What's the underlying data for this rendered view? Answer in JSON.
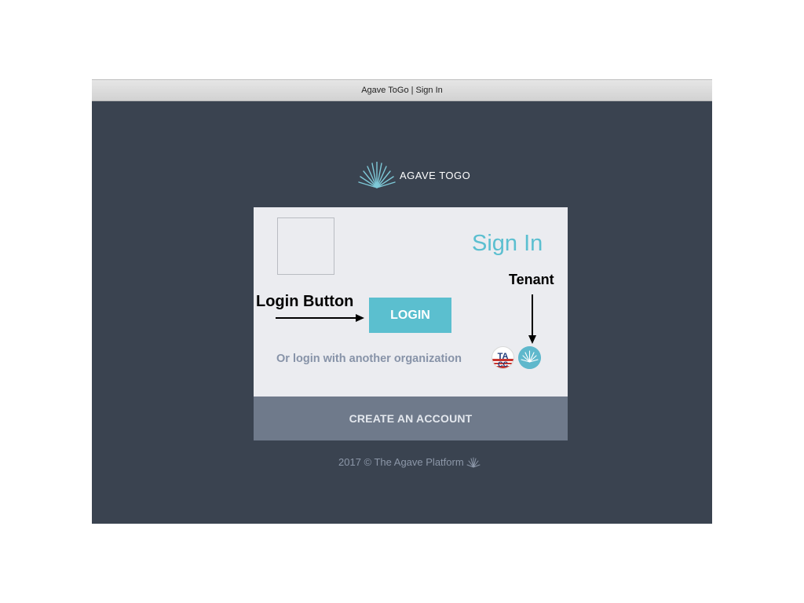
{
  "window": {
    "title": "Agave ToGo | Sign In",
    "background_color": "#3a4350"
  },
  "brand": {
    "name": "AGAVE TOGO",
    "icon": "agave-leaf-icon"
  },
  "signin_card": {
    "title": "Sign In",
    "login_button": "LOGIN",
    "alt_login_text": "Or login with another organization",
    "tenants": [
      {
        "name": "TACC",
        "icon": "tacc-tenant-icon"
      },
      {
        "name": "Agave",
        "icon": "agave-tenant-icon"
      }
    ],
    "accent_color": "#5bbfcf"
  },
  "create_account": {
    "label": "CREATE AN ACCOUNT",
    "color": "#6f7a8b"
  },
  "footer": {
    "text": "2017 © The Agave Platform",
    "icon": "agave-leaf-icon"
  },
  "annotations": {
    "login_button_label": "Login Button",
    "tenant_label": "Tenant"
  }
}
